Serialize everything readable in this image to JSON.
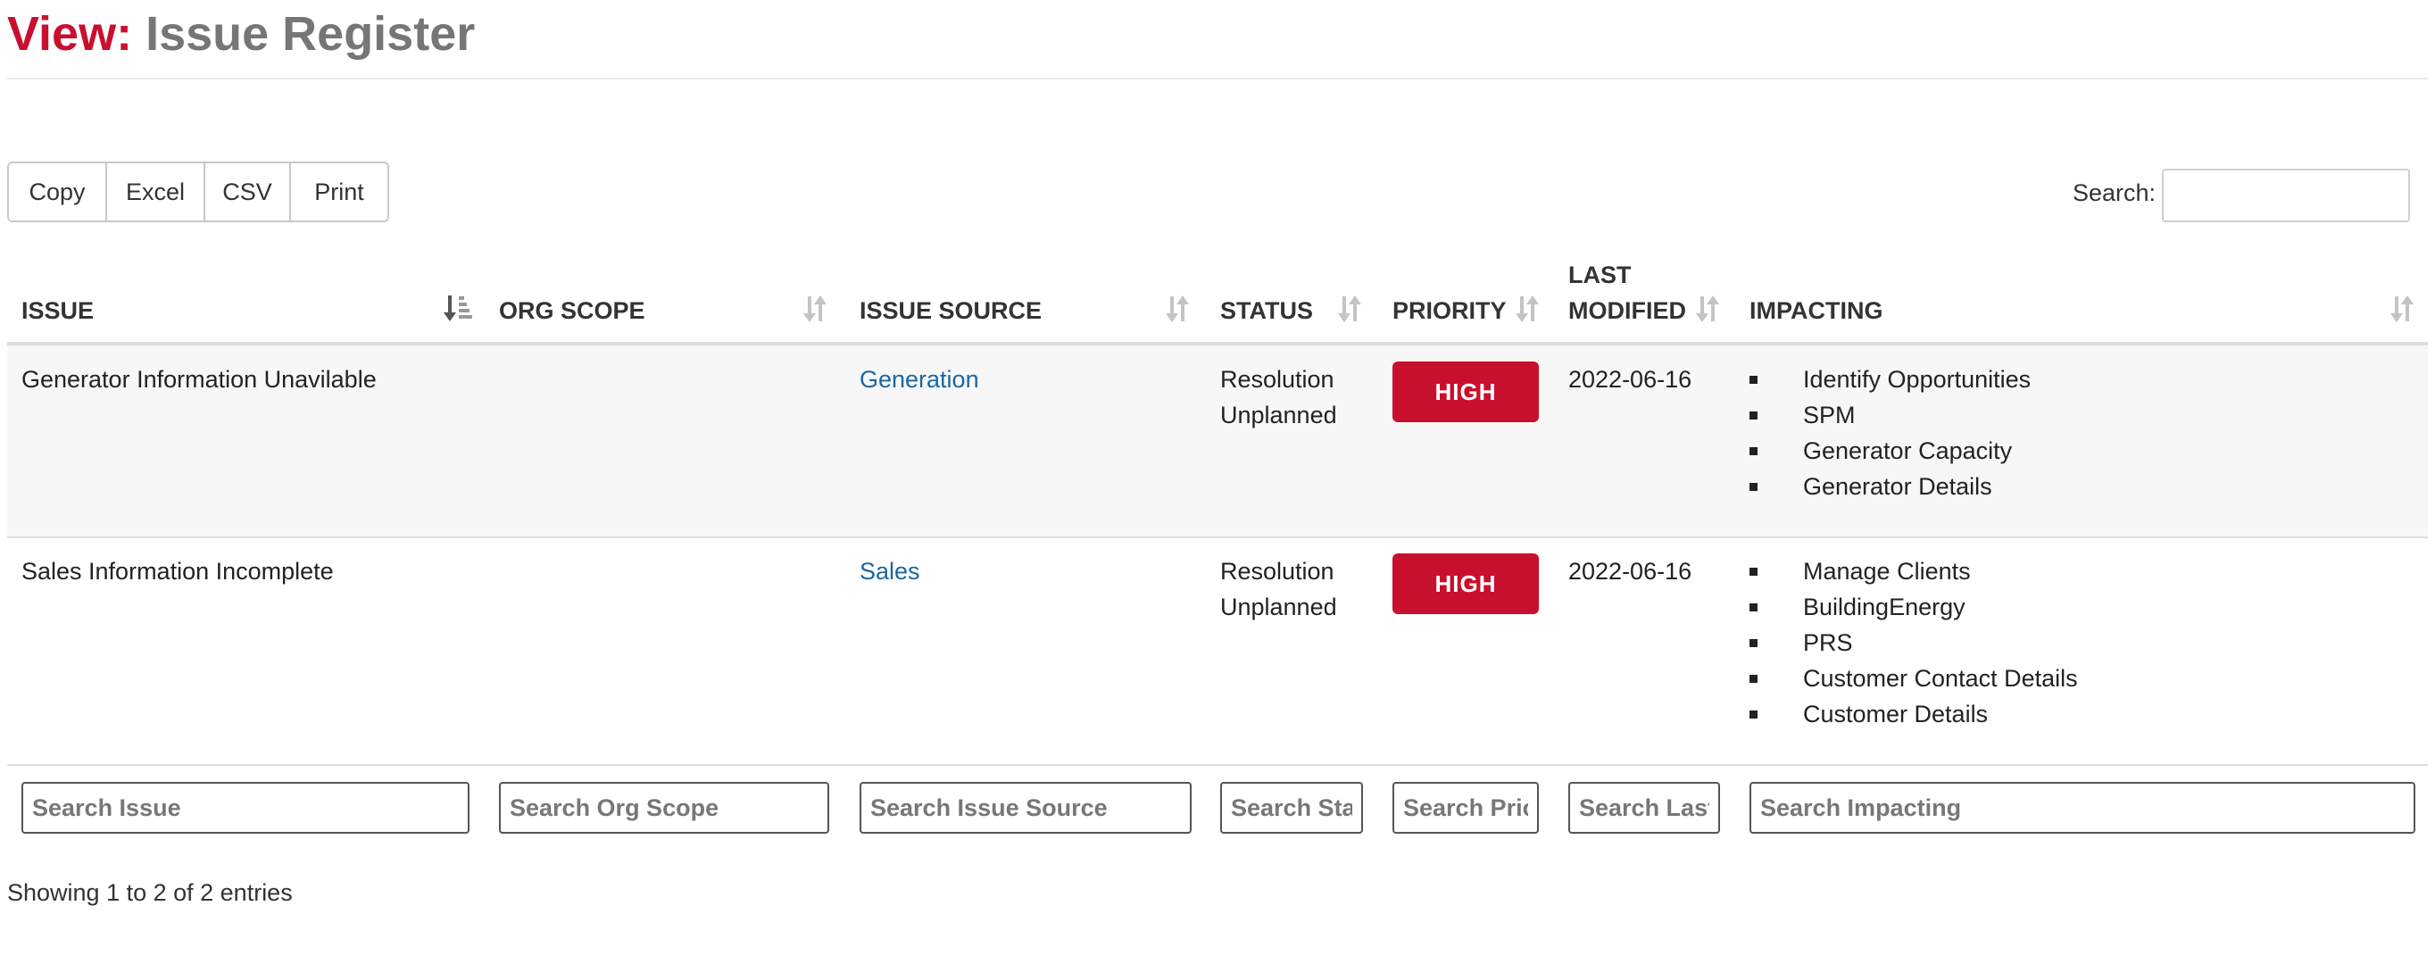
{
  "title": {
    "prefix": "View:",
    "name": "Issue Register"
  },
  "buttons": [
    "Copy",
    "Excel",
    "CSV",
    "Print"
  ],
  "search": {
    "label": "Search:",
    "value": ""
  },
  "columns": [
    {
      "label": "ISSUE",
      "sort": "ascending"
    },
    {
      "label": "ORG SCOPE",
      "sort": "none"
    },
    {
      "label": "ISSUE SOURCE",
      "sort": "none"
    },
    {
      "label": "STATUS",
      "sort": "none"
    },
    {
      "label": "PRIORITY",
      "sort": "none"
    },
    {
      "label_line1": "LAST",
      "label_line2": "MODIFIED",
      "sort": "none"
    },
    {
      "label": "IMPACTING",
      "sort": "none"
    }
  ],
  "rows": [
    {
      "issue": "Generator Information Unavilable",
      "org_scope": "",
      "source": "Generation",
      "status_line1": "Resolution",
      "status_line2": "Unplanned",
      "priority": "HIGH",
      "modified": "2022-06-16",
      "impacting": [
        "Identify Opportunities",
        "SPM",
        "Generator Capacity",
        "Generator Details"
      ]
    },
    {
      "issue": "Sales Information Incomplete",
      "org_scope": "",
      "source": "Sales",
      "status_line1": "Resolution",
      "status_line2": "Unplanned",
      "priority": "HIGH",
      "modified": "2022-06-16",
      "impacting": [
        "Manage Clients",
        "BuildingEnergy",
        "PRS",
        "Customer Contact Details",
        "Customer Details"
      ]
    }
  ],
  "filters": [
    "Search Issue",
    "Search Org Scope",
    "Search Issue Source",
    "Search Status",
    "Search Priority",
    "Search Last Modified",
    "Search Impacting"
  ],
  "info": "Showing 1 to 2 of 2 entries",
  "colors": {
    "accent": "#c8102e",
    "title_gray": "#767676",
    "link": "#1a66a3",
    "stripe": "#f7f7f7"
  },
  "icons": {
    "sort_asc": "sort-ascending-icon",
    "sort_both": "sort-both-icon",
    "bullet": "square-bullet-icon"
  }
}
